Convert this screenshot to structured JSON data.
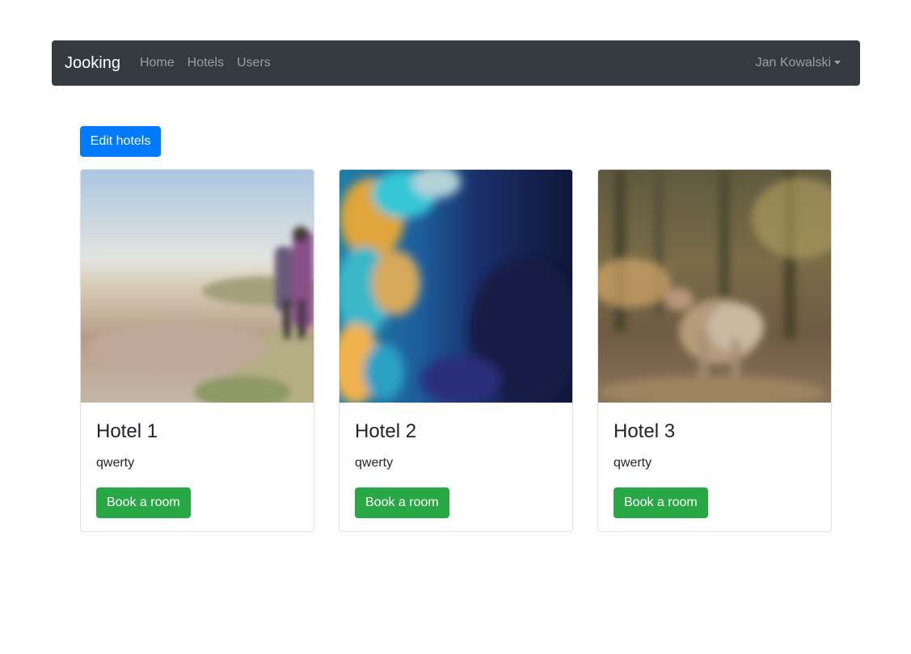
{
  "navbar": {
    "brand": "Jooking",
    "links": [
      {
        "label": "Home"
      },
      {
        "label": "Hotels"
      },
      {
        "label": "Users"
      }
    ],
    "user": "Jan Kowalski"
  },
  "actions": {
    "edit_label": "Edit hotels"
  },
  "hotels": [
    {
      "title": "Hotel 1",
      "description": "qwerty",
      "button": "Book a room"
    },
    {
      "title": "Hotel 2",
      "description": "qwerty",
      "button": "Book a room"
    },
    {
      "title": "Hotel 3",
      "description": "qwerty",
      "button": "Book a room"
    }
  ],
  "colors": {
    "navbar_bg": "#343a40",
    "primary": "#007bff",
    "success": "#28a745"
  }
}
